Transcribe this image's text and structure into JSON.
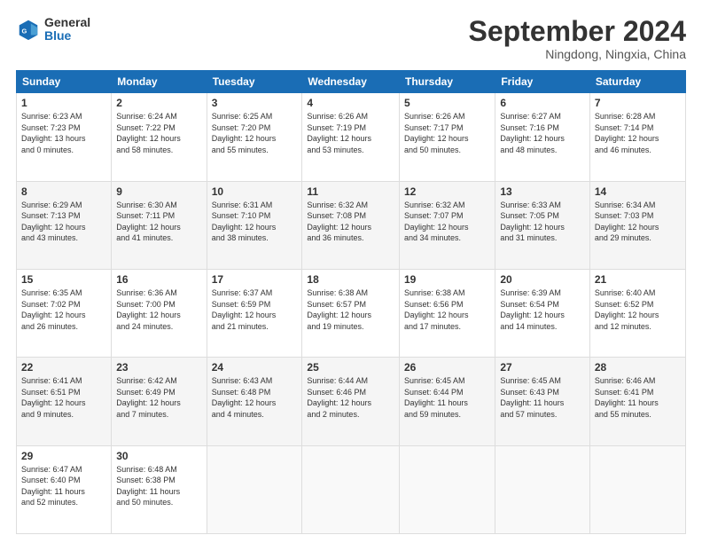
{
  "logo": {
    "general": "General",
    "blue": "Blue"
  },
  "header": {
    "month": "September 2024",
    "location": "Ningdong, Ningxia, China"
  },
  "days_of_week": [
    "Sunday",
    "Monday",
    "Tuesday",
    "Wednesday",
    "Thursday",
    "Friday",
    "Saturday"
  ],
  "weeks": [
    [
      {
        "day": "1",
        "info": "Sunrise: 6:23 AM\nSunset: 7:23 PM\nDaylight: 13 hours\nand 0 minutes."
      },
      {
        "day": "2",
        "info": "Sunrise: 6:24 AM\nSunset: 7:22 PM\nDaylight: 12 hours\nand 58 minutes."
      },
      {
        "day": "3",
        "info": "Sunrise: 6:25 AM\nSunset: 7:20 PM\nDaylight: 12 hours\nand 55 minutes."
      },
      {
        "day": "4",
        "info": "Sunrise: 6:26 AM\nSunset: 7:19 PM\nDaylight: 12 hours\nand 53 minutes."
      },
      {
        "day": "5",
        "info": "Sunrise: 6:26 AM\nSunset: 7:17 PM\nDaylight: 12 hours\nand 50 minutes."
      },
      {
        "day": "6",
        "info": "Sunrise: 6:27 AM\nSunset: 7:16 PM\nDaylight: 12 hours\nand 48 minutes."
      },
      {
        "day": "7",
        "info": "Sunrise: 6:28 AM\nSunset: 7:14 PM\nDaylight: 12 hours\nand 46 minutes."
      }
    ],
    [
      {
        "day": "8",
        "info": "Sunrise: 6:29 AM\nSunset: 7:13 PM\nDaylight: 12 hours\nand 43 minutes."
      },
      {
        "day": "9",
        "info": "Sunrise: 6:30 AM\nSunset: 7:11 PM\nDaylight: 12 hours\nand 41 minutes."
      },
      {
        "day": "10",
        "info": "Sunrise: 6:31 AM\nSunset: 7:10 PM\nDaylight: 12 hours\nand 38 minutes."
      },
      {
        "day": "11",
        "info": "Sunrise: 6:32 AM\nSunset: 7:08 PM\nDaylight: 12 hours\nand 36 minutes."
      },
      {
        "day": "12",
        "info": "Sunrise: 6:32 AM\nSunset: 7:07 PM\nDaylight: 12 hours\nand 34 minutes."
      },
      {
        "day": "13",
        "info": "Sunrise: 6:33 AM\nSunset: 7:05 PM\nDaylight: 12 hours\nand 31 minutes."
      },
      {
        "day": "14",
        "info": "Sunrise: 6:34 AM\nSunset: 7:03 PM\nDaylight: 12 hours\nand 29 minutes."
      }
    ],
    [
      {
        "day": "15",
        "info": "Sunrise: 6:35 AM\nSunset: 7:02 PM\nDaylight: 12 hours\nand 26 minutes."
      },
      {
        "day": "16",
        "info": "Sunrise: 6:36 AM\nSunset: 7:00 PM\nDaylight: 12 hours\nand 24 minutes."
      },
      {
        "day": "17",
        "info": "Sunrise: 6:37 AM\nSunset: 6:59 PM\nDaylight: 12 hours\nand 21 minutes."
      },
      {
        "day": "18",
        "info": "Sunrise: 6:38 AM\nSunset: 6:57 PM\nDaylight: 12 hours\nand 19 minutes."
      },
      {
        "day": "19",
        "info": "Sunrise: 6:38 AM\nSunset: 6:56 PM\nDaylight: 12 hours\nand 17 minutes."
      },
      {
        "day": "20",
        "info": "Sunrise: 6:39 AM\nSunset: 6:54 PM\nDaylight: 12 hours\nand 14 minutes."
      },
      {
        "day": "21",
        "info": "Sunrise: 6:40 AM\nSunset: 6:52 PM\nDaylight: 12 hours\nand 12 minutes."
      }
    ],
    [
      {
        "day": "22",
        "info": "Sunrise: 6:41 AM\nSunset: 6:51 PM\nDaylight: 12 hours\nand 9 minutes."
      },
      {
        "day": "23",
        "info": "Sunrise: 6:42 AM\nSunset: 6:49 PM\nDaylight: 12 hours\nand 7 minutes."
      },
      {
        "day": "24",
        "info": "Sunrise: 6:43 AM\nSunset: 6:48 PM\nDaylight: 12 hours\nand 4 minutes."
      },
      {
        "day": "25",
        "info": "Sunrise: 6:44 AM\nSunset: 6:46 PM\nDaylight: 12 hours\nand 2 minutes."
      },
      {
        "day": "26",
        "info": "Sunrise: 6:45 AM\nSunset: 6:44 PM\nDaylight: 11 hours\nand 59 minutes."
      },
      {
        "day": "27",
        "info": "Sunrise: 6:45 AM\nSunset: 6:43 PM\nDaylight: 11 hours\nand 57 minutes."
      },
      {
        "day": "28",
        "info": "Sunrise: 6:46 AM\nSunset: 6:41 PM\nDaylight: 11 hours\nand 55 minutes."
      }
    ],
    [
      {
        "day": "29",
        "info": "Sunrise: 6:47 AM\nSunset: 6:40 PM\nDaylight: 11 hours\nand 52 minutes."
      },
      {
        "day": "30",
        "info": "Sunrise: 6:48 AM\nSunset: 6:38 PM\nDaylight: 11 hours\nand 50 minutes."
      },
      {
        "day": "",
        "info": ""
      },
      {
        "day": "",
        "info": ""
      },
      {
        "day": "",
        "info": ""
      },
      {
        "day": "",
        "info": ""
      },
      {
        "day": "",
        "info": ""
      }
    ]
  ]
}
